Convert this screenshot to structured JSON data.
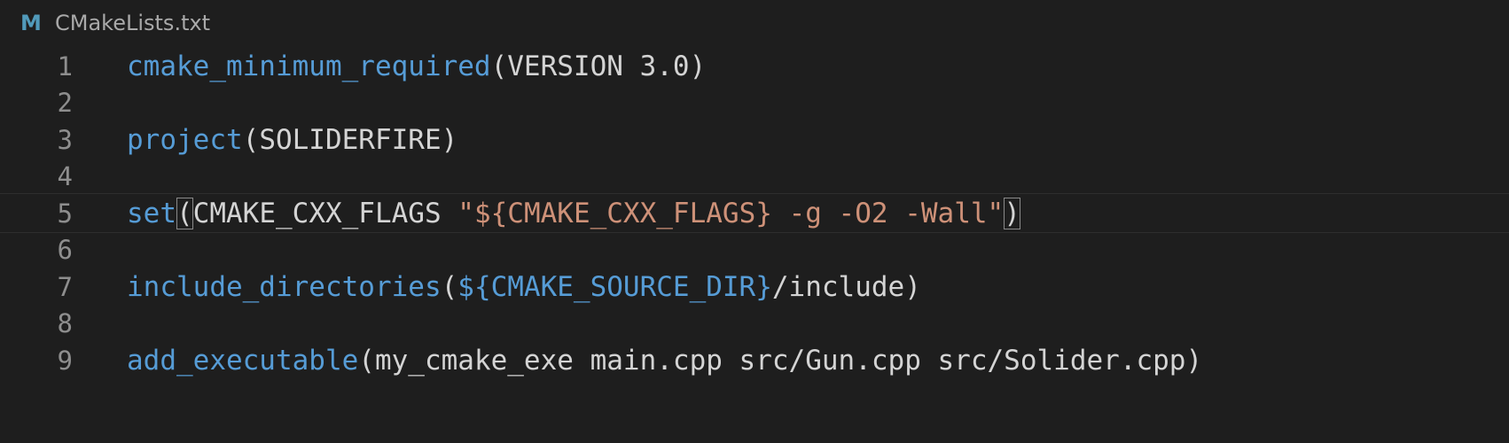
{
  "tab": {
    "icon": "M",
    "file_name": "CMakeLists.txt"
  },
  "colors": {
    "background": "#1e1e1e",
    "function": "#569cd6",
    "plain": "#d4d4d4",
    "string": "#ce9178",
    "variable": "#4ec9b0",
    "line_number": "#8e8e8e"
  },
  "lines": [
    {
      "number": "1",
      "tokens": [
        {
          "type": "func",
          "text": "cmake_minimum_required"
        },
        {
          "type": "plain",
          "text": "(VERSION 3.0)"
        }
      ]
    },
    {
      "number": "2",
      "tokens": []
    },
    {
      "number": "3",
      "tokens": [
        {
          "type": "func",
          "text": "project"
        },
        {
          "type": "plain",
          "text": "(SOLIDERFIRE)"
        }
      ]
    },
    {
      "number": "4",
      "tokens": []
    },
    {
      "number": "5",
      "current": true,
      "tokens": [
        {
          "type": "func",
          "text": "set"
        },
        {
          "type": "plain",
          "text": "(",
          "match": true
        },
        {
          "type": "plain",
          "text": "CMAKE_CXX_FLAGS "
        },
        {
          "type": "str",
          "text": "\"${CMAKE_CXX_FLAGS} -g -O2 -Wall\""
        },
        {
          "type": "plain",
          "text": ")",
          "match": true
        }
      ]
    },
    {
      "number": "6",
      "tokens": []
    },
    {
      "number": "7",
      "tokens": [
        {
          "type": "func",
          "text": "include_directories"
        },
        {
          "type": "plain",
          "text": "("
        },
        {
          "type": "func",
          "text": "${CMAKE_SOURCE_DIR}"
        },
        {
          "type": "plain",
          "text": "/include)"
        }
      ]
    },
    {
      "number": "8",
      "tokens": []
    },
    {
      "number": "9",
      "tokens": [
        {
          "type": "func",
          "text": "add_executable"
        },
        {
          "type": "plain",
          "text": "(my_cmake_exe main.cpp src/Gun.cpp src/Solider.cpp)"
        }
      ]
    }
  ]
}
